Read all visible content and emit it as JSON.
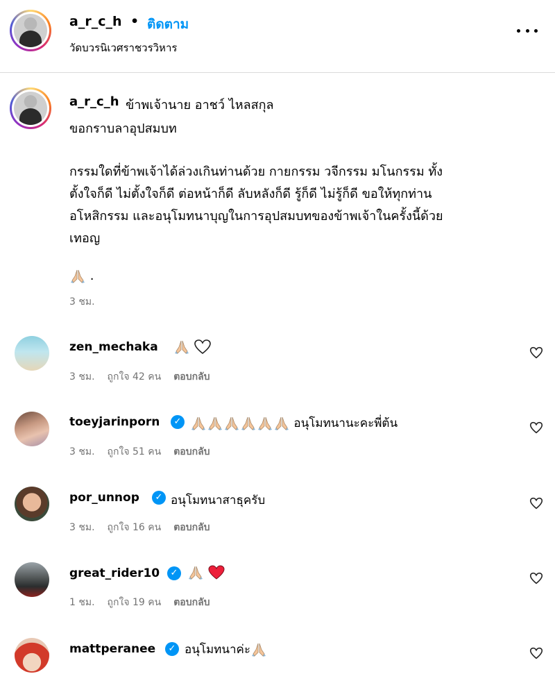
{
  "header": {
    "username": "a_r_c_h",
    "dot": "•",
    "follow_label": "ติดตาม",
    "location": "วัดบวรนิเวศราชวรวิหาร"
  },
  "caption": {
    "username": "a_r_c_h",
    "lines": [
      "ข้าพเจ้านาย อาชว์ ไหลสกุล",
      "ขอกราบลาอุปสมบท",
      "กรรมใดที่ข้าพเจ้าได้ล่วงเกินท่านด้วย กายกรรม วจีกรรม มโนกรรม ทั้ง",
      "ตั้งใจก็ดี ไม่ตั้งใจก็ดี ต่อหน้าก็ดี ลับหลังก็ดี รู้ก็ดี ไม่รู้ก็ดี ขอให้ทุกท่าน",
      "อโหสิกรรม และอนุโมทนาบุญในการอุปสมบทของข้าพเจ้าในครั้งนี้ด้วย",
      "เทอญ"
    ],
    "emoji_end": ".",
    "time": "3 ชม."
  },
  "comments": [
    {
      "username": "zen_mechaka",
      "text": "",
      "time": "3 ชม.",
      "likes": "ถูกใจ 42 คน",
      "reply": "ตอบกลับ"
    },
    {
      "username": "toeyjarinporn",
      "text": "อนุโมทนานะคะพี่ต้น",
      "time": "3 ชม.",
      "likes": "ถูกใจ 51 คน",
      "reply": "ตอบกลับ"
    },
    {
      "username": "por_unnop",
      "text": "อนุโมทนาสาธุครับ",
      "time": "3 ชม.",
      "likes": "ถูกใจ 16 คน",
      "reply": "ตอบกลับ"
    },
    {
      "username": "great_rider10",
      "text": "",
      "time": "1 ชม.",
      "likes": "ถูกใจ 19 คน",
      "reply": "ตอบกลับ"
    },
    {
      "username": "mattperanee",
      "text": "อนุโมทนาค่ะ"
    }
  ],
  "icons": {
    "verified": "✓",
    "heart_red": "#ed1f3a",
    "accent": "#0095f6"
  }
}
